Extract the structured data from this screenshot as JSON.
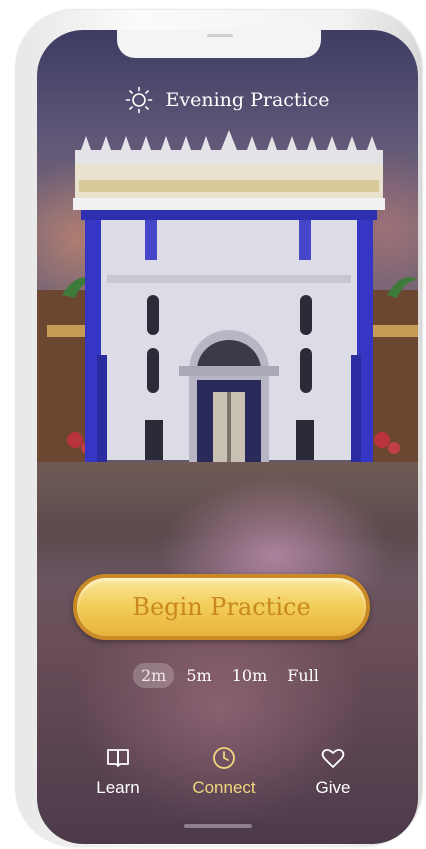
{
  "header": {
    "title": "Evening Practice",
    "icon": "sun-icon"
  },
  "main": {
    "begin_label": "Begin Practice",
    "durations": [
      {
        "label": "2m",
        "selected": true
      },
      {
        "label": "5m",
        "selected": false
      },
      {
        "label": "10m",
        "selected": false
      },
      {
        "label": "Full",
        "selected": false
      }
    ]
  },
  "tabs": [
    {
      "label": "Learn",
      "icon": "book-icon",
      "active": false
    },
    {
      "label": "Connect",
      "icon": "clock-icon",
      "active": true
    },
    {
      "label": "Give",
      "icon": "heart-icon",
      "active": false
    }
  ],
  "colors": {
    "accent_gold": "#f1d67e",
    "button_gold": "#f3cf5c",
    "button_text": "#c8881f"
  }
}
